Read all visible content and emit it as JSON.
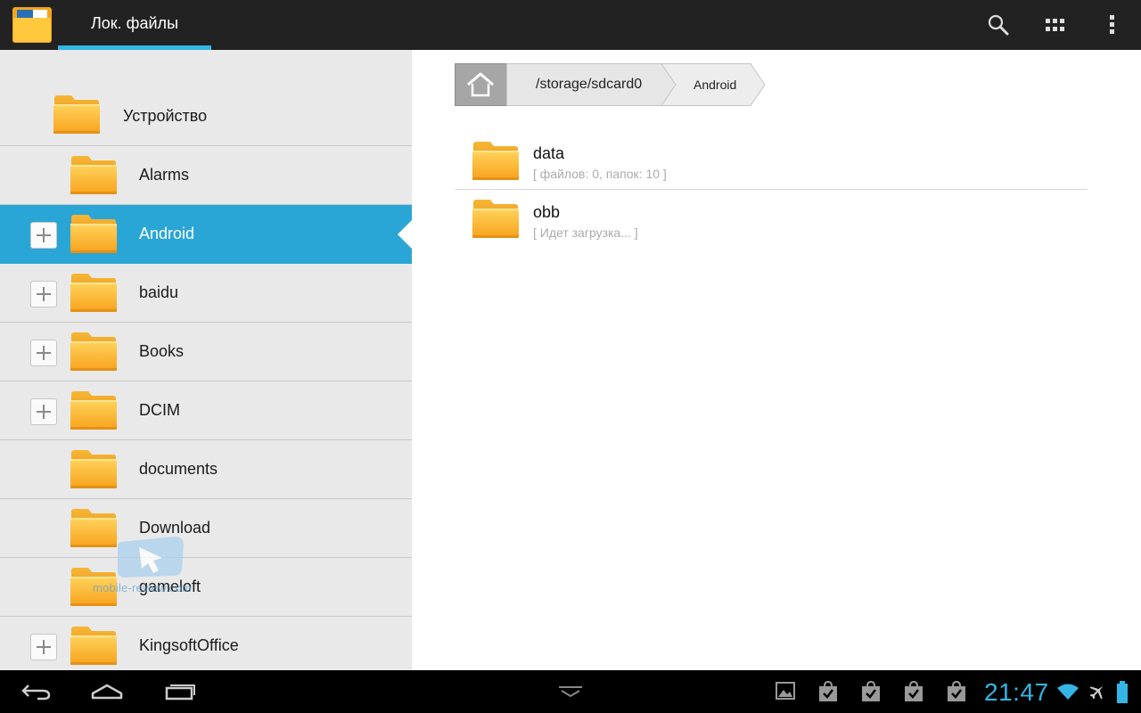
{
  "actionbar": {
    "tab_label": "Лок. файлы",
    "accent": "#33b5e5"
  },
  "tree": {
    "root_label": "Устройство",
    "items": [
      {
        "label": "Alarms",
        "expandable": false,
        "selected": false
      },
      {
        "label": "Android",
        "expandable": true,
        "selected": true
      },
      {
        "label": "baidu",
        "expandable": true,
        "selected": false
      },
      {
        "label": "Books",
        "expandable": true,
        "selected": false
      },
      {
        "label": "DCIM",
        "expandable": true,
        "selected": false
      },
      {
        "label": "documents",
        "expandable": false,
        "selected": false
      },
      {
        "label": "Download",
        "expandable": false,
        "selected": false
      },
      {
        "label": "gameloft",
        "expandable": false,
        "selected": false
      },
      {
        "label": "KingsoftOffice",
        "expandable": true,
        "selected": false
      }
    ],
    "selected_color": "#2aa6d6"
  },
  "breadcrumb": {
    "items": [
      "/storage/sdcard0",
      "Android"
    ]
  },
  "files": [
    {
      "name": "data",
      "info": "[ файлов: 0, папок: 10 ]"
    },
    {
      "name": "obb",
      "info": "[ Идет загрузка... ]"
    }
  ],
  "watermark": {
    "text": "mobile-review.com"
  },
  "statusbar": {
    "clock": "21:47",
    "clock_color": "#33b5e5"
  },
  "icons": {
    "app": "file-manager-folder-icon",
    "search": "search-icon",
    "grid": "grid-view-icon",
    "overflow": "overflow-menu-icon",
    "folder": "folder-icon",
    "home": "home-icon",
    "back": "back-icon",
    "home_nav": "home-nav-icon",
    "recents": "recent-apps-icon",
    "hide_keyboard": "chevron-down-icon",
    "gallery": "gallery-notification-icon",
    "store": "store-notification-icon",
    "wifi": "wifi-icon",
    "airplane": "airplane-mode-icon",
    "battery": "battery-icon"
  }
}
